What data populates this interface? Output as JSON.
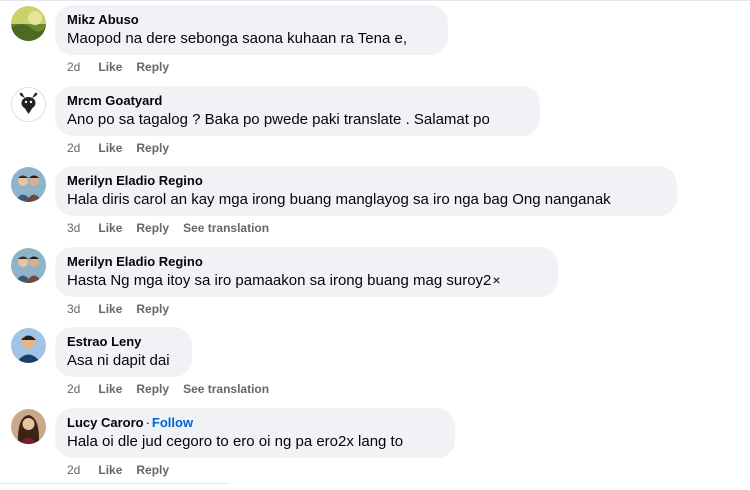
{
  "comments": [
    {
      "author": "Mikz Abuso",
      "text": "Maopod na dere sebonga saona kuhaan ra Tena e,",
      "time": "2d",
      "like": "Like",
      "reply": "Reply",
      "avatar": "nature-icon"
    },
    {
      "author": "Mrcm Goatyard",
      "text": "Ano po sa tagalog ? Baka po pwede paki translate . Salamat po",
      "time": "2d",
      "like": "Like",
      "reply": "Reply",
      "avatar": "goat-logo-icon"
    },
    {
      "author": "Merilyn Eladio Regino",
      "text": "Hala diris carol an kay mga irong buang manglayog sa iro nga bag Ong nanganak",
      "time": "3d",
      "like": "Like",
      "reply": "Reply",
      "see_translation": "See translation",
      "avatar": "people-icon"
    },
    {
      "author": "Merilyn Eladio Regino",
      "text": "Hasta Ng mga itoy sa iro pamaakon sa irong buang mag suroy2",
      "text_suffix": "×",
      "time": "3d",
      "like": "Like",
      "reply": "Reply",
      "avatar": "people-icon"
    },
    {
      "author": "Estrao Leny",
      "text": "Asa ni dapit dai",
      "time": "2d",
      "like": "Like",
      "reply": "Reply",
      "see_translation": "See translation",
      "avatar": "person-icon"
    },
    {
      "author": "Lucy Caroro",
      "follow": "Follow",
      "separator": "·",
      "text": "Hala oi dle jud cegoro to ero oi ng pa ero2x lang to",
      "time": "2d",
      "like": "Like",
      "reply": "Reply",
      "avatar": "woman-icon"
    }
  ],
  "colors": {
    "bubble": "#f0f2f5",
    "meta": "#65676b",
    "link": "#0064d1"
  }
}
